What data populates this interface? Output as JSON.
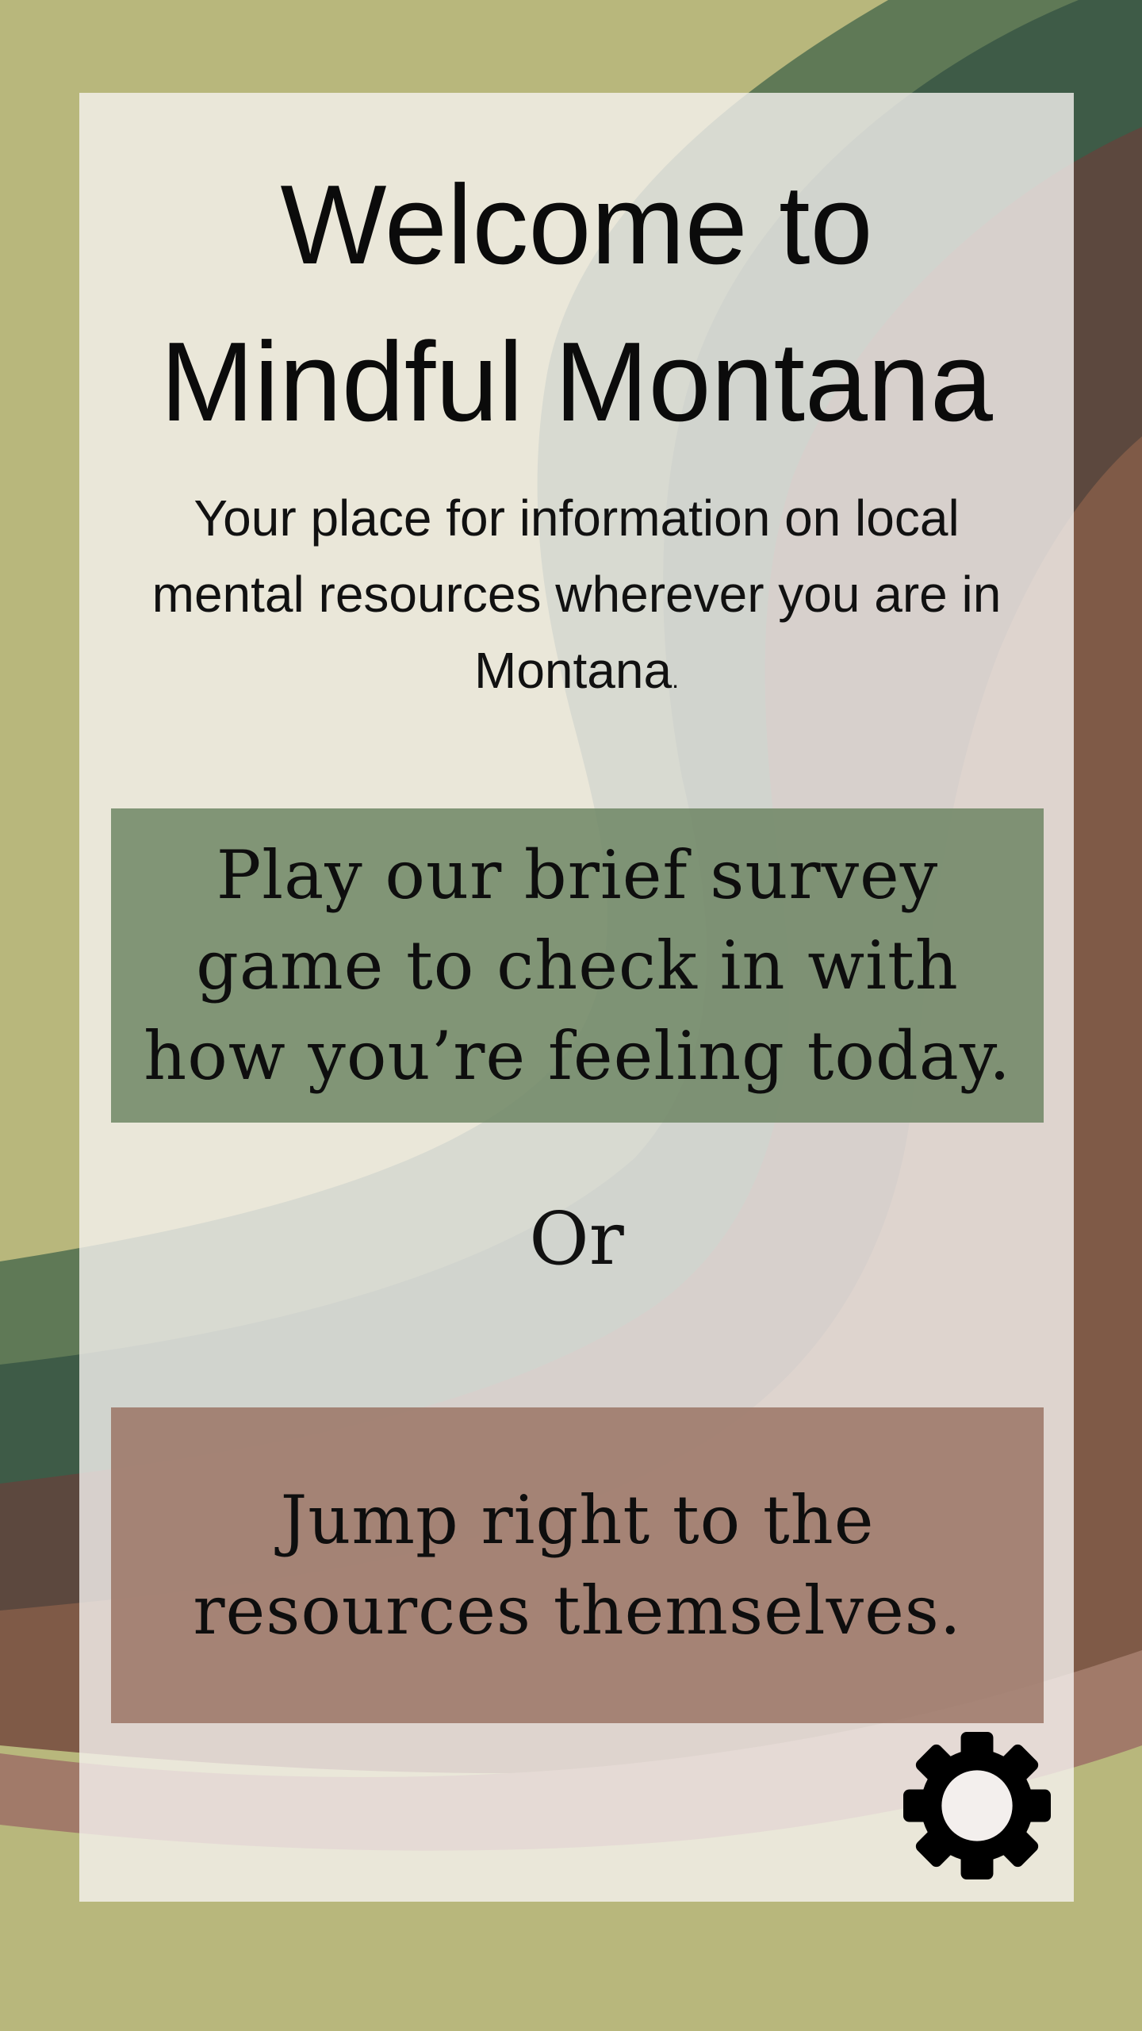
{
  "header": {
    "title_line1": "Welcome to",
    "title_line2": "Mindful Montana",
    "subtitle": "Your place for information on local mental resources wherever you are in Montana",
    "subtitle_end": "."
  },
  "actions": {
    "survey_label": "Play our brief survey game to check in with how you’re feeling today.",
    "separator": "Or",
    "resources_label": "Jump right to the resources themselves."
  },
  "icons": {
    "settings": "gear-icon"
  },
  "colors": {
    "background": "#b8b77c",
    "band_green_light": "#5f7956",
    "band_green_dark": "#3e5b47",
    "band_brown_dark": "#5c483e",
    "band_brown": "#7f5a47",
    "band_clay": "#a17a69",
    "panel": "#f6f2f0",
    "survey_button": "#6a8260",
    "resources_button": "#997262"
  }
}
